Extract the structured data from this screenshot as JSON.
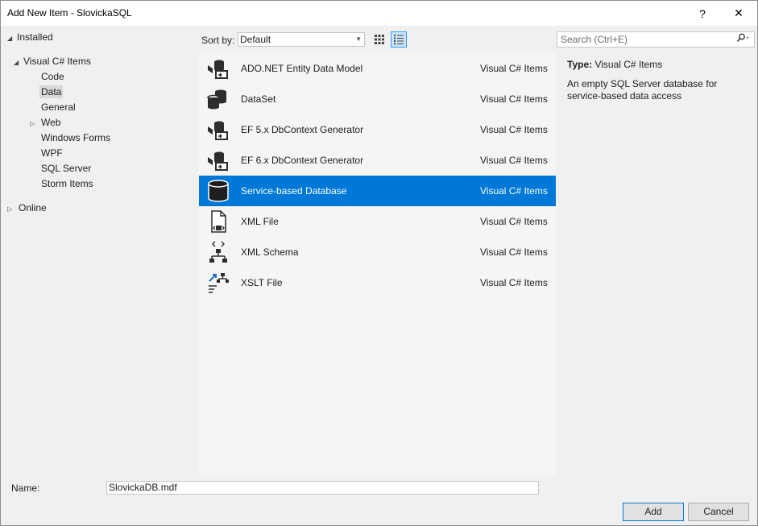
{
  "window": {
    "title": "Add New Item - SlovickaSQL",
    "help_label": "?",
    "close_label": "✕"
  },
  "tree": {
    "installed": "Installed",
    "visual_cs_items": "Visual C# Items",
    "children": [
      "Code",
      "Data",
      "General",
      "Web",
      "Windows Forms",
      "WPF",
      "SQL Server",
      "Storm Items"
    ],
    "selected": "Data",
    "online": "Online"
  },
  "toolbar": {
    "sort_by_label": "Sort by:",
    "sort_value": "Default",
    "search_placeholder": "Search (Ctrl+E)"
  },
  "items": [
    {
      "name": "ADO.NET Entity Data Model",
      "category": "Visual C# Items",
      "icon": "entity-model-icon"
    },
    {
      "name": "DataSet",
      "category": "Visual C# Items",
      "icon": "dataset-icon"
    },
    {
      "name": "EF 5.x DbContext Generator",
      "category": "Visual C# Items",
      "icon": "ef-generator-icon"
    },
    {
      "name": "EF 6.x DbContext Generator",
      "category": "Visual C# Items",
      "icon": "ef-generator-icon"
    },
    {
      "name": "Service-based Database",
      "category": "Visual C# Items",
      "icon": "database-icon",
      "selected": true
    },
    {
      "name": "XML File",
      "category": "Visual C# Items",
      "icon": "xml-file-icon"
    },
    {
      "name": "XML Schema",
      "category": "Visual C# Items",
      "icon": "xml-schema-icon"
    },
    {
      "name": "XSLT File",
      "category": "Visual C# Items",
      "icon": "xslt-file-icon"
    }
  ],
  "details": {
    "type_key": "Type:",
    "type_value": "Visual C# Items",
    "description": "An empty SQL Server database for service-based data access"
  },
  "footer": {
    "name_label": "Name:",
    "name_value": "SlovickaDB.mdf",
    "add_label": "Add",
    "cancel_label": "Cancel"
  },
  "colors": {
    "selection": "#0078d7",
    "background": "#f0f0f0",
    "list_background": "#f5f5f5"
  }
}
